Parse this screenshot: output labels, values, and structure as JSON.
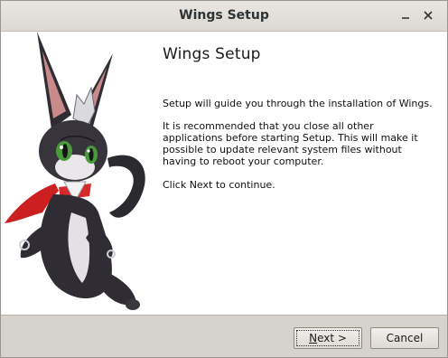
{
  "window": {
    "title": "Wings Setup",
    "minimize_glyph": "_",
    "close_glyph": "✕"
  },
  "main": {
    "heading": "Wings Setup",
    "paragraphs": [
      "Setup will guide you through the installation of Wings.",
      "It is recommended that you close all other applications before starting Setup. This will make it possible to update relevant system files without having to reboot your computer.",
      "Click Next to continue."
    ]
  },
  "buttons": {
    "next_mnemonic": "N",
    "next_rest": "ext >",
    "cancel": "Cancel"
  },
  "icons": {
    "minimize": "minimize-icon",
    "close": "close-icon",
    "side_art": "cat-mascot-illustration"
  }
}
